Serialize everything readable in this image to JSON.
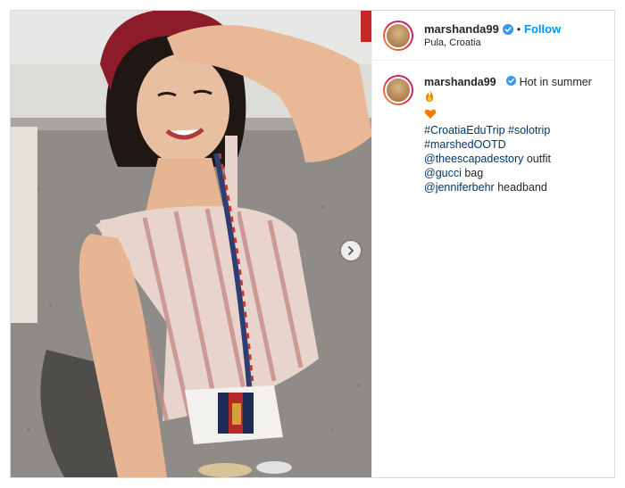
{
  "post": {
    "username": "marshanda99",
    "follow_label": "Follow",
    "separator": "•",
    "location": "Pula, Croatia",
    "verified_icon": "verified-badge-icon"
  },
  "caption": {
    "username": "marshanda99",
    "text": "Hot in summer",
    "emoji_1": "fire-emoji",
    "emoji_2": "orange-heart-emoji",
    "hashtags_line1": "#CroatiaEduTrip #solotrip",
    "hashtags_line2": "#marshedOOTD",
    "mention_1": "@theescapadestory",
    "mention_1_suffix": "outfit",
    "mention_2": "@gucci",
    "mention_2_suffix": "bag",
    "mention_3": "@jenniferbehr",
    "mention_3_suffix": "headband"
  },
  "colors": {
    "link_blue": "#00376b",
    "follow_blue": "#0095f6",
    "verified_blue": "#3897f0"
  }
}
